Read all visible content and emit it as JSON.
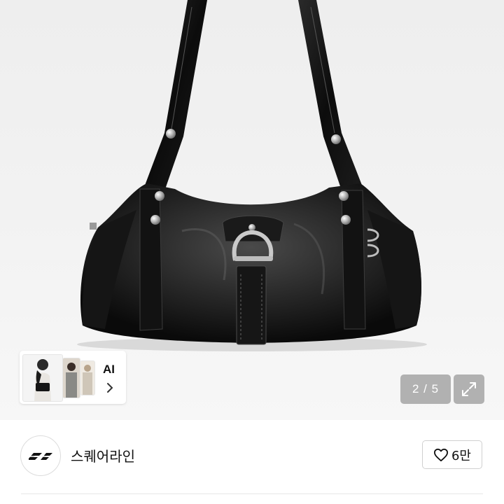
{
  "gallery": {
    "image_alt": "black leather shoulder bag",
    "counter": "2 / 5",
    "expand_icon": "expand-arrows-icon"
  },
  "ai_chip": {
    "label": "AI",
    "chevron_icon": "chevron-right-icon"
  },
  "shop": {
    "name": "스퀘어라인",
    "logo_icon": "shop-logo-icon"
  },
  "like": {
    "icon": "heart-outline-icon",
    "count": "6만"
  }
}
